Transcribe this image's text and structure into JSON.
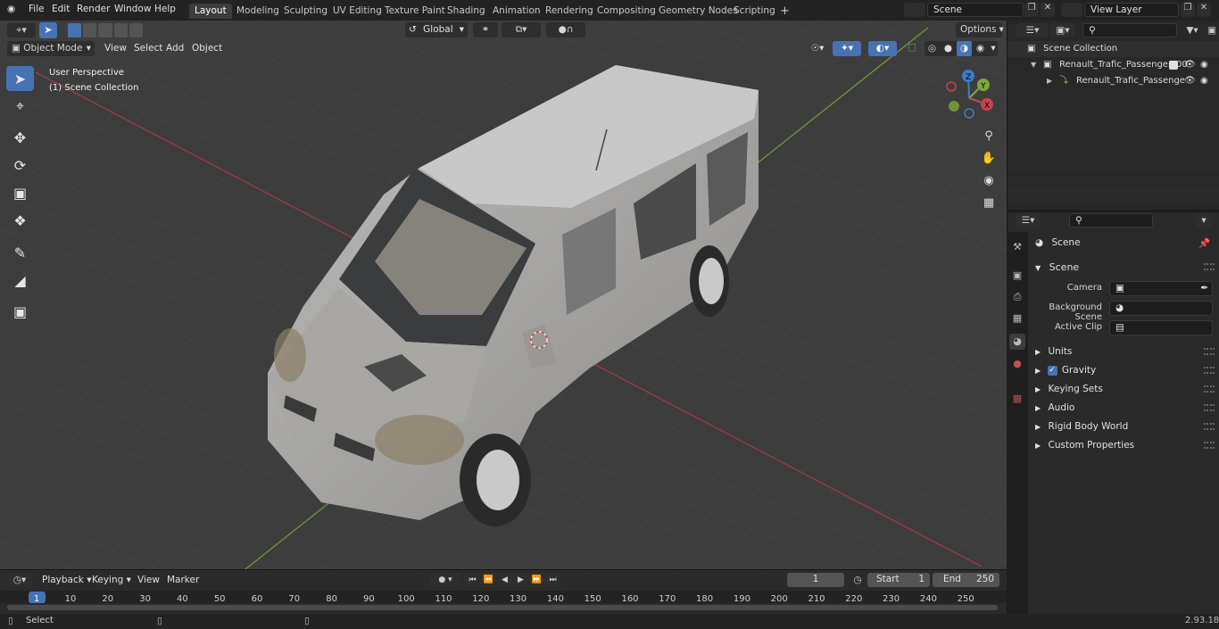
{
  "app": {
    "version": "2.93.18"
  },
  "topbar": {
    "menus": [
      "File",
      "Edit",
      "Render",
      "Window",
      "Help"
    ],
    "workspaces": [
      "Layout",
      "Modeling",
      "Sculpting",
      "UV Editing",
      "Texture Paint",
      "Shading",
      "Animation",
      "Rendering",
      "Compositing",
      "Geometry Nodes",
      "Scripting"
    ],
    "active_workspace": "Layout",
    "add_tab": "+",
    "scene_name": "Scene",
    "view_layer": "View Layer"
  },
  "viewport": {
    "mode": "Object Mode",
    "menus": [
      "View",
      "Select",
      "Add",
      "Object"
    ],
    "transform_orientation": "Global",
    "options_label": "Options",
    "overlay_line1": "User Perspective",
    "overlay_line2": "(1) Scene Collection",
    "gizmo": {
      "x": "X",
      "y": "Y",
      "z": "Z"
    },
    "colors": {
      "x_axis": "#c8434e",
      "y_axis": "#7aa83a",
      "z_axis": "#3a7ec8",
      "background": "#3c3c3c",
      "accent": "#4772b3"
    }
  },
  "outliner": {
    "search_placeholder": "",
    "rows": [
      {
        "label": "Scene Collection"
      },
      {
        "label": "Renault_Trafic_Passenger_00"
      },
      {
        "label": "Renault_Trafic_Passenge"
      }
    ]
  },
  "properties": {
    "header": "Scene",
    "panel_title": "Scene",
    "fields": [
      {
        "label": "Camera",
        "value": ""
      },
      {
        "label": "Background Scene",
        "value": ""
      },
      {
        "label": "Active Clip",
        "value": ""
      }
    ],
    "sections": [
      "Units",
      "Gravity",
      "Keying Sets",
      "Audio",
      "Rigid Body World",
      "Custom Properties"
    ],
    "gravity_checked": true
  },
  "timeline": {
    "menus": [
      "Playback",
      "Keying",
      "View",
      "Marker"
    ],
    "current_frame": "1",
    "start_label": "Start",
    "start_value": "1",
    "end_label": "End",
    "end_value": "250",
    "ticks": [
      "1",
      "10",
      "20",
      "30",
      "40",
      "50",
      "60",
      "70",
      "80",
      "90",
      "100",
      "110",
      "120",
      "130",
      "140",
      "150",
      "160",
      "170",
      "180",
      "190",
      "200",
      "210",
      "220",
      "230",
      "240",
      "250"
    ]
  },
  "statusbar": {
    "left": "Select",
    "version": "2.93.18"
  }
}
